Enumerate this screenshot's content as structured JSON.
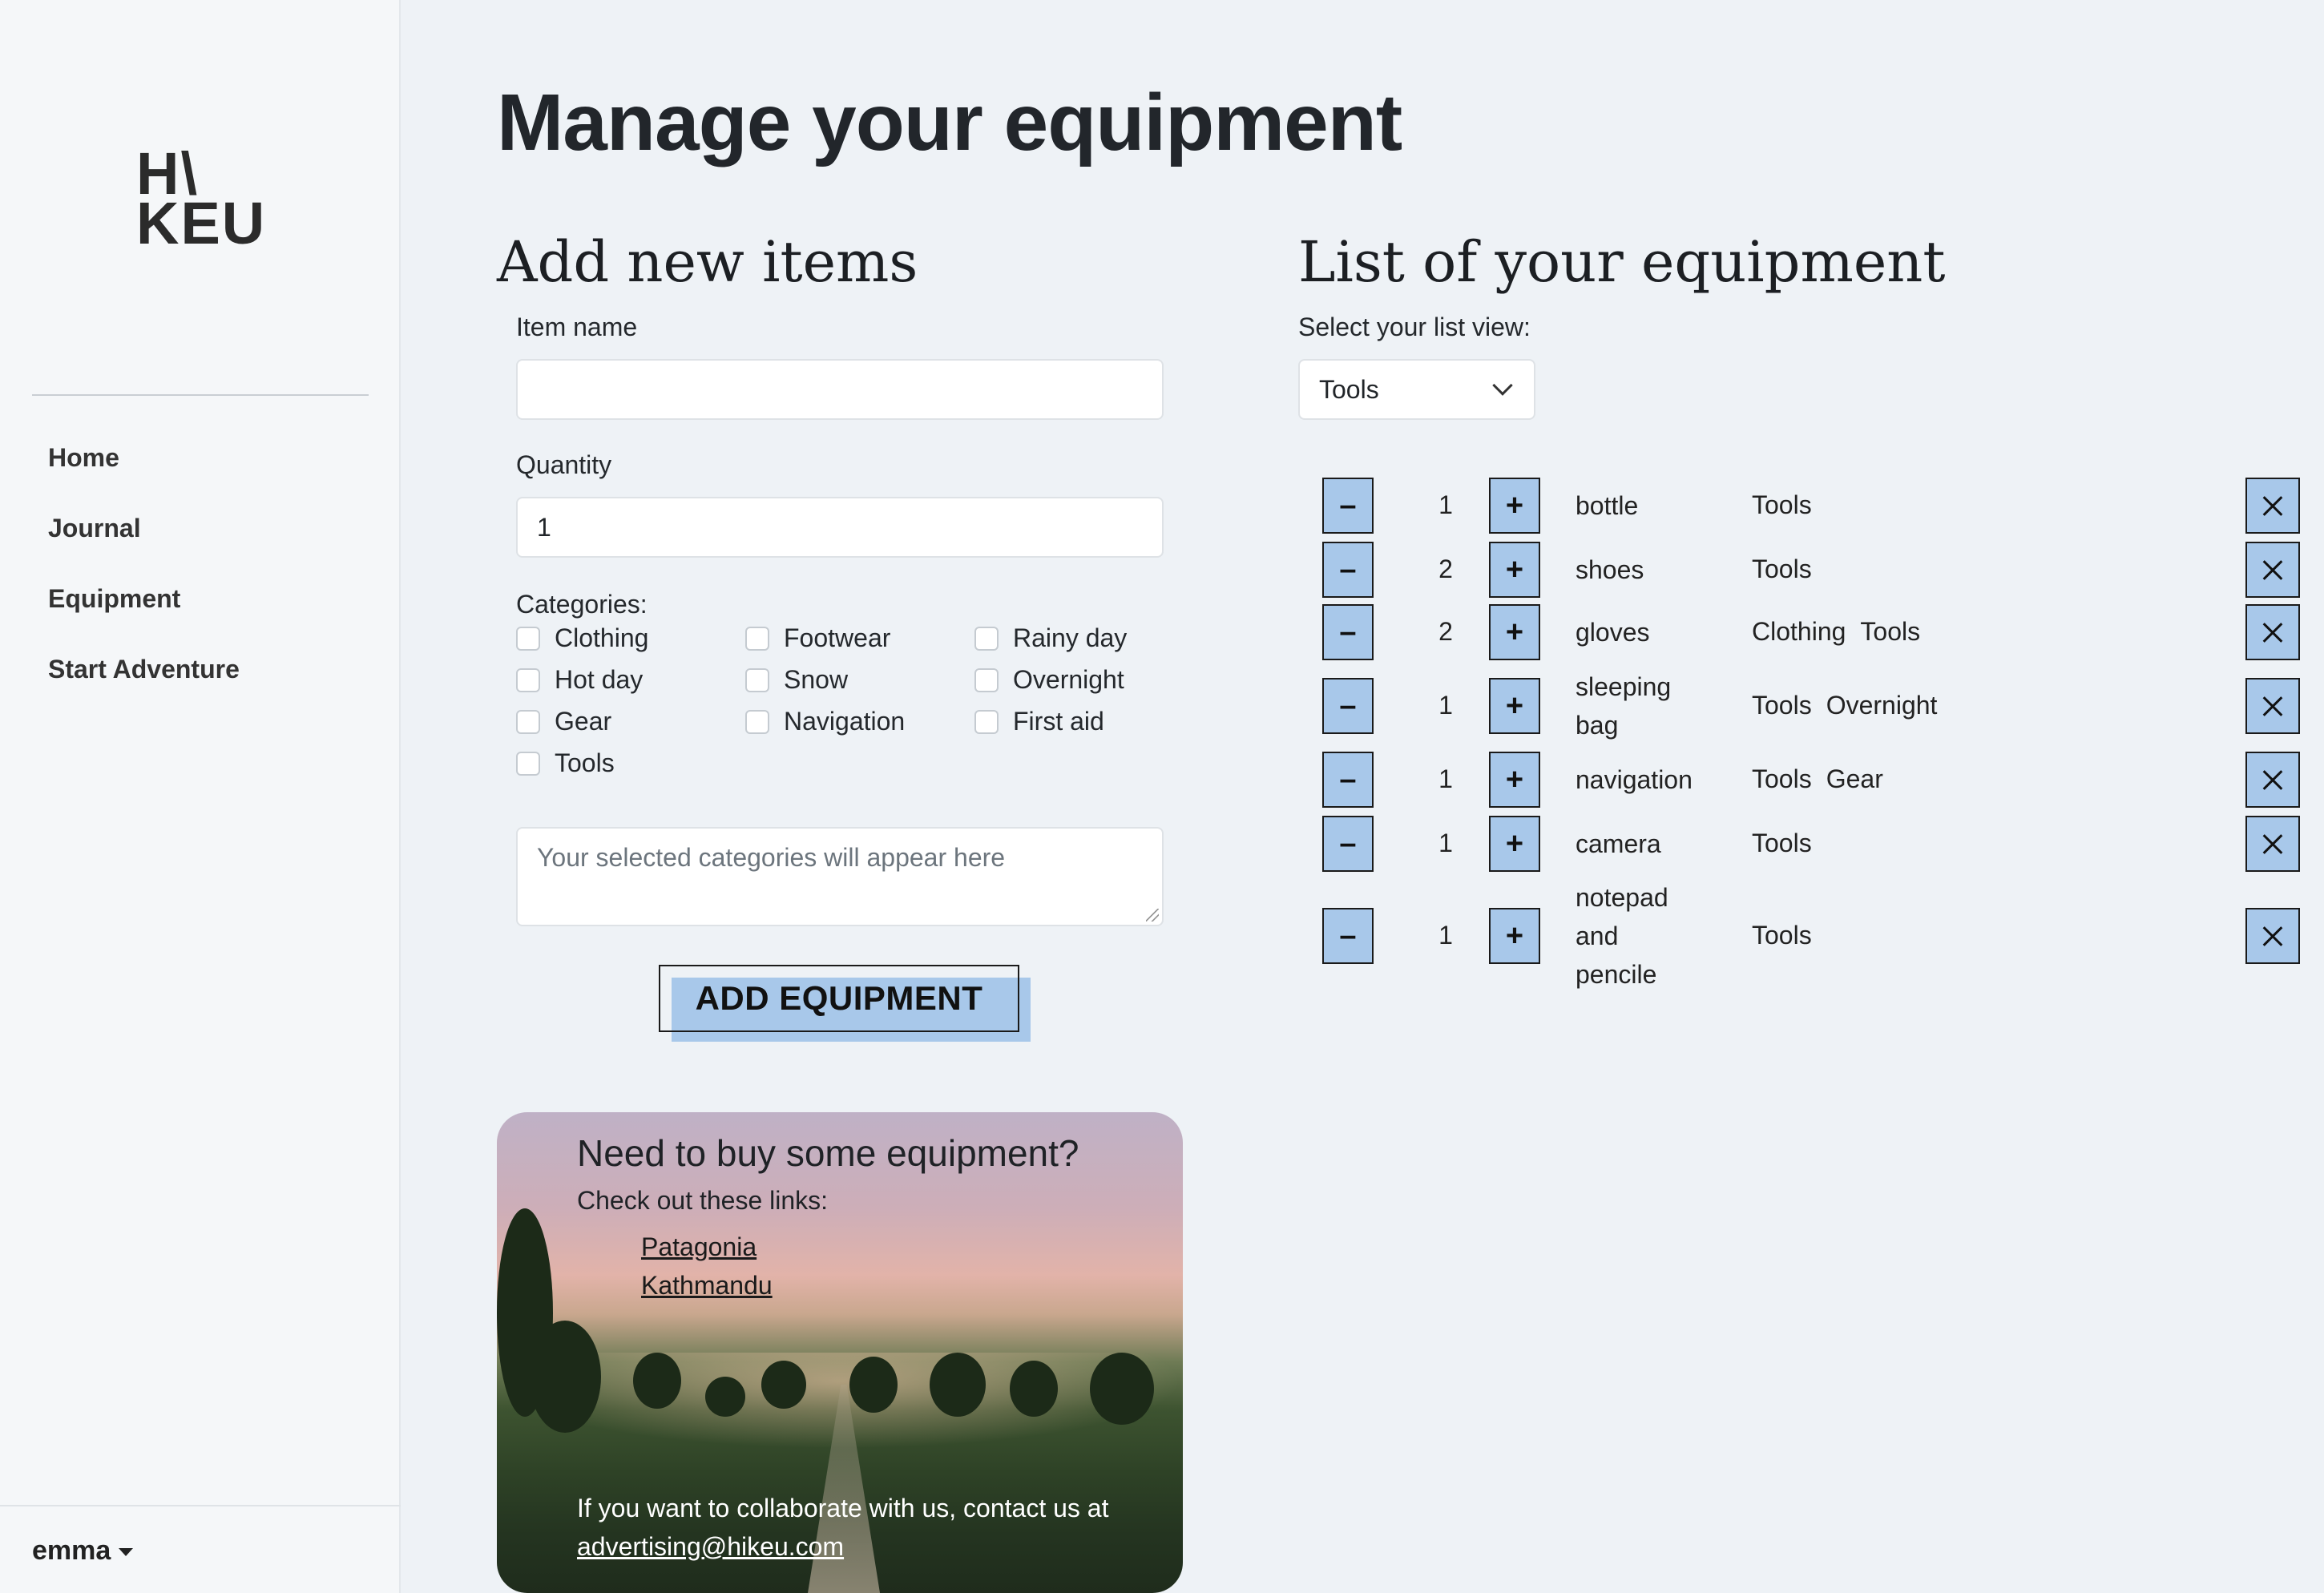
{
  "sidebar": {
    "logo": {
      "line1": "H\\",
      "line2": "KEU"
    },
    "nav": [
      "Home",
      "Journal",
      "Equipment",
      "Start Adventure"
    ],
    "user": "emma"
  },
  "main": {
    "title": "Manage your equipment",
    "add_section": {
      "title": "Add new items",
      "item_name_label": "Item name",
      "item_name_value": "",
      "quantity_label": "Quantity",
      "quantity_value": "1",
      "categories_label": "Categories:",
      "categories": [
        "Clothing",
        "Footwear",
        "Rainy day",
        "Hot day",
        "Snow",
        "Overnight",
        "Gear",
        "Navigation",
        "First aid",
        "Tools"
      ],
      "selected_placeholder": "Your selected categories will appear here",
      "add_button": "ADD EQUIPMENT"
    },
    "promo": {
      "title": "Need to buy some equipment?",
      "subtitle": "Check out these links:",
      "links": [
        "Patagonia",
        "Kathmandu"
      ],
      "footer_text": "If you want to collaborate with us, contact us at",
      "footer_email": " advertising@hikeu.com"
    },
    "list_section": {
      "title": "List of your equipment",
      "view_label": "Select your list view:",
      "view_value": "Tools",
      "decrement_label": "–",
      "increment_label": "+",
      "items": [
        {
          "qty": "1",
          "name": "bottle",
          "categories": [
            "Tools"
          ]
        },
        {
          "qty": "2",
          "name": "shoes",
          "categories": [
            "Tools"
          ]
        },
        {
          "qty": "2",
          "name": "gloves",
          "categories": [
            "Clothing",
            "Tools"
          ]
        },
        {
          "qty": "1",
          "name": "sleeping bag",
          "categories": [
            "Tools",
            "Overnight"
          ]
        },
        {
          "qty": "1",
          "name": "navigation",
          "categories": [
            "Tools",
            "Gear"
          ]
        },
        {
          "qty": "1",
          "name": "camera",
          "categories": [
            "Tools"
          ]
        },
        {
          "qty": "1",
          "name": "notepad and pencile",
          "categories": [
            "Tools"
          ]
        }
      ]
    }
  },
  "colors": {
    "button_blue": "#a8c8ea",
    "background": "#eef2f6",
    "sidebar": "#f5f7f9"
  }
}
